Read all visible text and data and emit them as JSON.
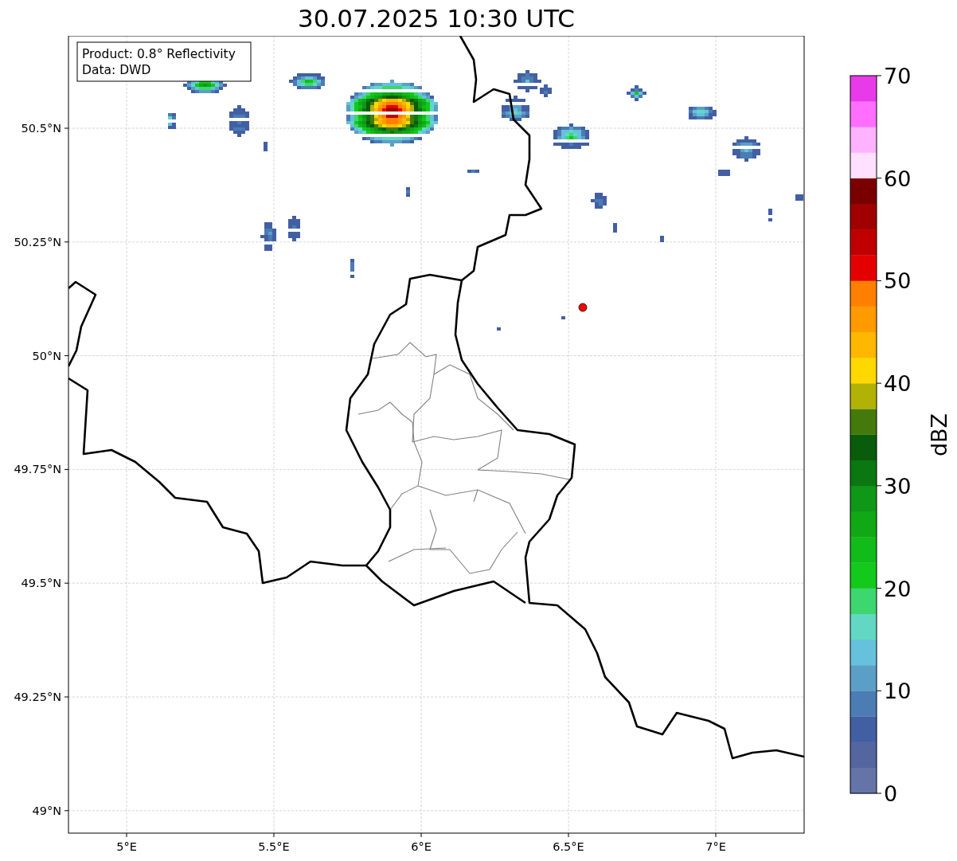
{
  "title": "30.07.2025 10:30 UTC",
  "map": {
    "info_box": [
      "Product: 0.8° Reflectivity",
      "Data: DWD"
    ],
    "x_ticks": [
      "5°E",
      "5.5°E",
      "6°E",
      "6.5°E",
      "7°E"
    ],
    "y_ticks": [
      "50.5°N",
      "50.25°N",
      "50°N",
      "49.75°N",
      "49.5°N",
      "49.25°N",
      "49°N"
    ]
  },
  "colorbar": {
    "label": "dBZ",
    "ticks": [
      "70",
      "60",
      "50",
      "40",
      "30",
      "20",
      "10",
      "0"
    ],
    "bins": [
      {
        "color": "#6474a6"
      },
      {
        "color": "#5366a0"
      },
      {
        "color": "#435fa3"
      },
      {
        "color": "#4b7cb3"
      },
      {
        "color": "#5b9fc6"
      },
      {
        "color": "#66c1dc"
      },
      {
        "color": "#62d8c4"
      },
      {
        "color": "#3ed66e"
      },
      {
        "color": "#12c91c"
      },
      {
        "color": "#11bb1a"
      },
      {
        "color": "#10a814"
      },
      {
        "color": "#0f9717"
      },
      {
        "color": "#0a7711"
      },
      {
        "color": "#085c0b"
      },
      {
        "color": "#447a0b"
      },
      {
        "color": "#b0b305"
      },
      {
        "color": "#ffd800"
      },
      {
        "color": "#ffb700"
      },
      {
        "color": "#ff9a00"
      },
      {
        "color": "#ff7f00"
      },
      {
        "color": "#e50000"
      },
      {
        "color": "#c00000"
      },
      {
        "color": "#a00000"
      },
      {
        "color": "#7a0000"
      },
      {
        "color": "#ffe0ff"
      },
      {
        "color": "#ffb3ff"
      },
      {
        "color": "#ff6fff"
      },
      {
        "color": "#e83ae8"
      }
    ]
  }
}
